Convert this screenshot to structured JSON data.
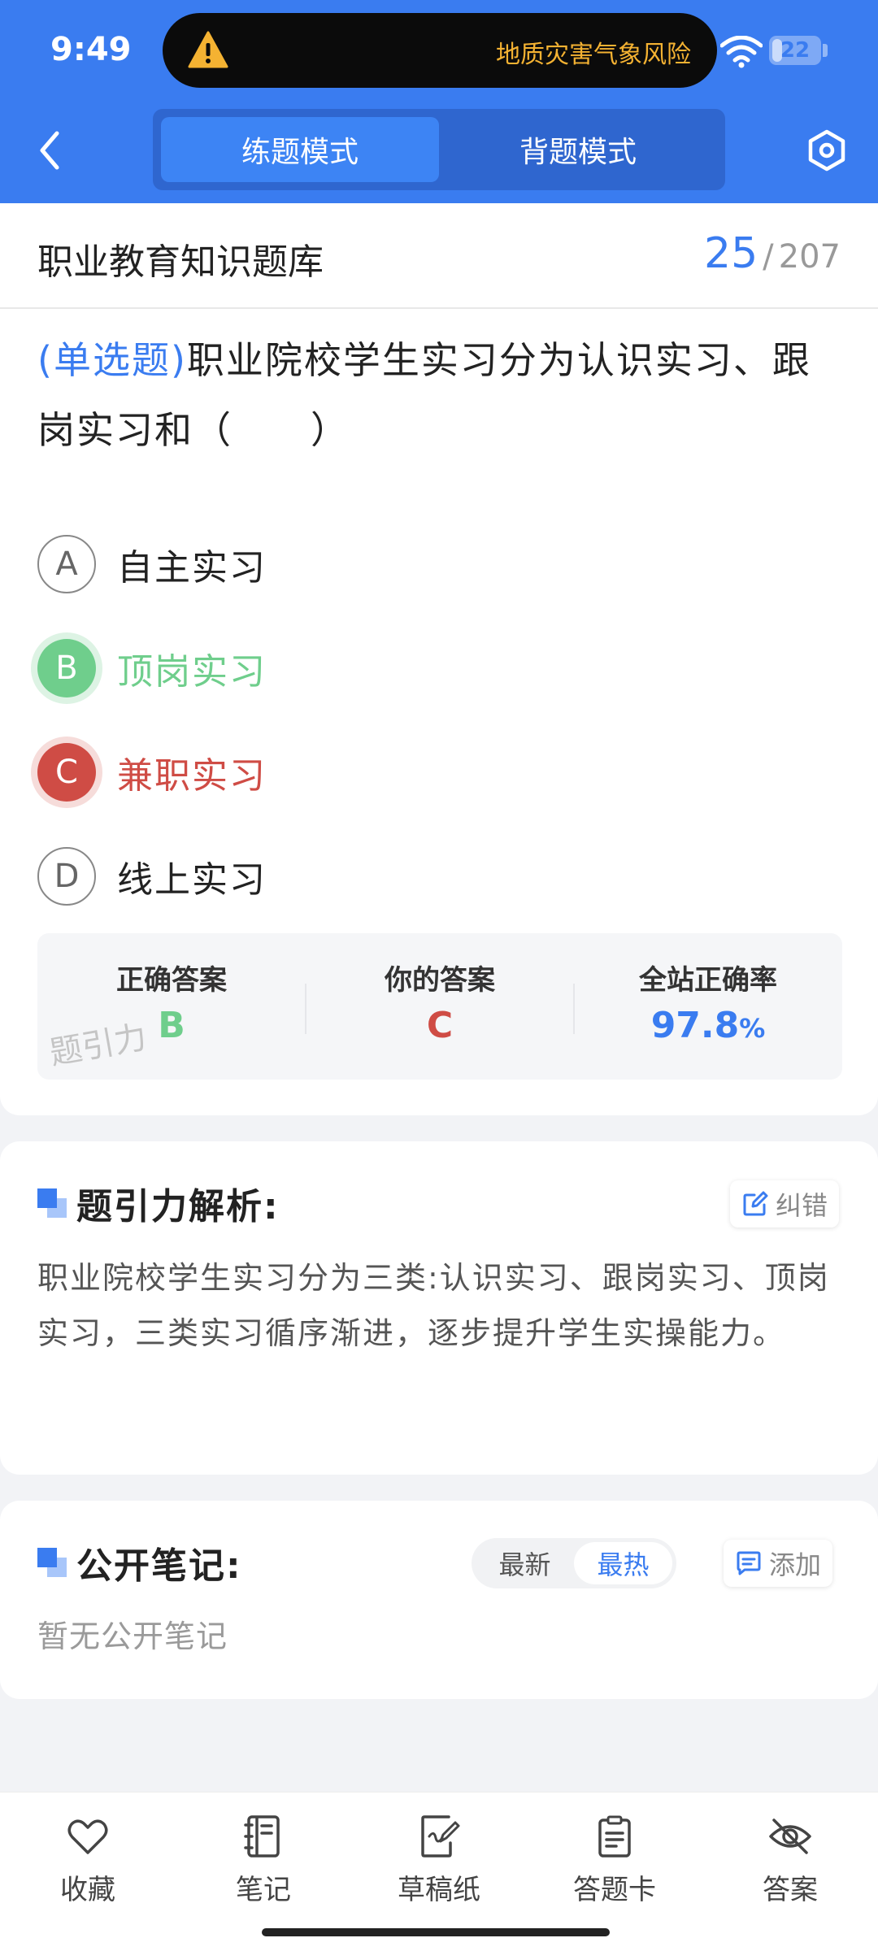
{
  "status_bar": {
    "time": "9:49",
    "alert_text": "地质灾害气象风险",
    "battery_level": 22,
    "battery_label": "22"
  },
  "header": {
    "tabs": [
      {
        "label": "练题模式",
        "active": true
      },
      {
        "label": "背题模式",
        "active": false
      }
    ],
    "back_icon": "chevron-left-icon",
    "settings_icon": "hexagon-settings-icon"
  },
  "question_card": {
    "bank_title": "职业教育知识题库",
    "progress_current": "25",
    "progress_separator": "/",
    "progress_total": "207",
    "question_type": "(单选题)",
    "question_text": "职业院校学生实习分为认识实习、跟岗实习和（　　）",
    "options": [
      {
        "letter": "A",
        "text": "自主实习",
        "state": "normal"
      },
      {
        "letter": "B",
        "text": "顶岗实习",
        "state": "correct"
      },
      {
        "letter": "C",
        "text": "兼职实习",
        "state": "wrong"
      },
      {
        "letter": "D",
        "text": "线上实习",
        "state": "normal"
      }
    ],
    "answer_summary": {
      "correct_label": "正确答案",
      "correct_value": "B",
      "your_label": "你的答案",
      "your_value": "C",
      "rate_label": "全站正确率",
      "rate_value": "97.8",
      "rate_unit": "%"
    },
    "watermark": "题引力"
  },
  "analysis": {
    "title": "题引力解析:",
    "report_button": "纠错",
    "text": "职业院校学生实习分为三类:认识实习、跟岗实习、顶岗实习，三类实习循序渐进，逐步提升学生实操能力。"
  },
  "notes": {
    "title": "公开笔记:",
    "sort_options": [
      {
        "label": "最新",
        "active": false
      },
      {
        "label": "最热",
        "active": true
      }
    ],
    "add_button": "添加",
    "empty_text": "暂无公开笔记"
  },
  "toolbar": [
    {
      "label": "收藏",
      "icon": "heart-icon"
    },
    {
      "label": "笔记",
      "icon": "notebook-icon"
    },
    {
      "label": "草稿纸",
      "icon": "draft-paper-icon"
    },
    {
      "label": "答题卡",
      "icon": "answer-sheet-icon"
    },
    {
      "label": "答案",
      "icon": "eye-off-icon"
    }
  ],
  "colors": {
    "brand": "#3a7cf0",
    "correct": "#6fce8c",
    "wrong": "#cf4c45",
    "alert": "#f4b232"
  }
}
